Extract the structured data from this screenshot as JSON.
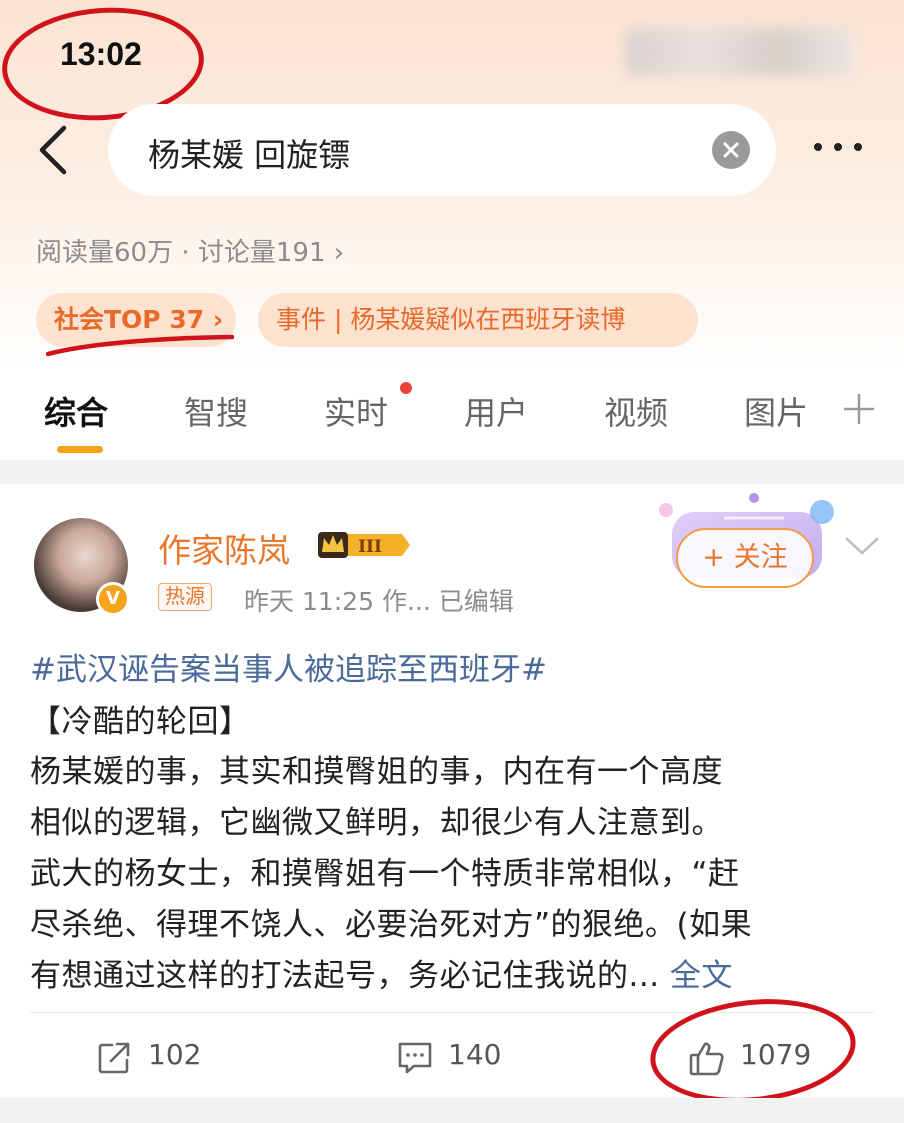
{
  "status_bar": {
    "time": "13:02"
  },
  "search": {
    "query": "杨某媛 回旋镖"
  },
  "topic": {
    "stats": "阅读量60万 · 讨论量191 ›",
    "rank_tag": "社会TOP 37 ›",
    "event_tag": "事件 | 杨某媛疑似在西班牙读博"
  },
  "tabs": [
    {
      "label": "综合"
    },
    {
      "label": "智搜"
    },
    {
      "label": "实时"
    },
    {
      "label": "用户"
    },
    {
      "label": "视频"
    },
    {
      "label": "图片"
    }
  ],
  "post": {
    "author": "作家陈岚",
    "level_badge": "III",
    "verify_mark": "V",
    "hot_tag": "热源",
    "meta": "昨天 11:25  作...  已编辑",
    "follow_label": "+ 关注",
    "hashtag": "#武汉诬告案当事人被追踪至西班牙#",
    "lines": [
      "【冷酷的轮回】",
      "杨某媛的事，其实和摸臀姐的事，内在有一个高度",
      "相似的逻辑，它幽微又鲜明，却很少有人注意到。",
      "武大的杨女士，和摸臀姐有一个特质非常相似，“赶",
      "尽杀绝、得理不饶人、必要治死对方”的狠绝。(如果",
      "有想通过这样的打法起号，务必记住我说的... "
    ],
    "full_text_link": "全文",
    "actions": {
      "reposts": "102",
      "comments": "140",
      "likes": "1079"
    }
  },
  "icons": [
    "back-arrow-icon",
    "clear-icon",
    "more-icon",
    "plus-icon",
    "chevron-down-icon",
    "share-icon",
    "comment-icon",
    "like-icon",
    "crown-icon"
  ],
  "colors": {
    "accent": "#e8762b",
    "link": "#4a6a9a",
    "annotation_red": "#d0121b",
    "tab_indicator": "#f7a21b"
  }
}
